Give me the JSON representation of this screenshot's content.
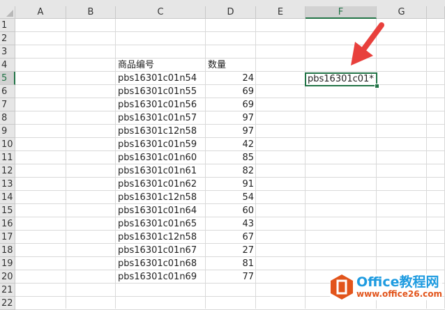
{
  "columns": [
    "A",
    "B",
    "C",
    "D",
    "E",
    "F",
    "G"
  ],
  "rows": [
    "1",
    "2",
    "3",
    "4",
    "5",
    "6",
    "7",
    "8",
    "9",
    "10",
    "11",
    "12",
    "13",
    "14",
    "15",
    "16",
    "17",
    "18",
    "19",
    "20",
    "21",
    "22"
  ],
  "selected_column": "F",
  "selected_row": "5",
  "headers": {
    "c": "商品编号",
    "d": "数量"
  },
  "records": [
    {
      "code": "pbs16301c01n54",
      "qty": "24"
    },
    {
      "code": "pbs16301c01n55",
      "qty": "69"
    },
    {
      "code": "pbs16301c01n56",
      "qty": "69"
    },
    {
      "code": "pbs16301c01n57",
      "qty": "97"
    },
    {
      "code": "pbs16301c12n58",
      "qty": "97"
    },
    {
      "code": "pbs16301c01n59",
      "qty": "42"
    },
    {
      "code": "pbs16301c01n60",
      "qty": "85"
    },
    {
      "code": "pbs16301c01n61",
      "qty": "82"
    },
    {
      "code": "pbs16301c01n62",
      "qty": "91"
    },
    {
      "code": "pbs16301c12n58",
      "qty": "54"
    },
    {
      "code": "pbs16301c01n64",
      "qty": "60"
    },
    {
      "code": "pbs16301c01n65",
      "qty": "43"
    },
    {
      "code": "pbs16301c12n58",
      "qty": "67"
    },
    {
      "code": "pbs16301c01n67",
      "qty": "27"
    },
    {
      "code": "pbs16301c01n68",
      "qty": "81"
    },
    {
      "code": "pbs16301c01n69",
      "qty": "77"
    }
  ],
  "active_cell_value": "pbs16301c01*",
  "watermark": {
    "title": "Office教程网",
    "url": "www.office26.com"
  },
  "colors": {
    "accent": "#217346",
    "arrow": "#e8403c"
  }
}
